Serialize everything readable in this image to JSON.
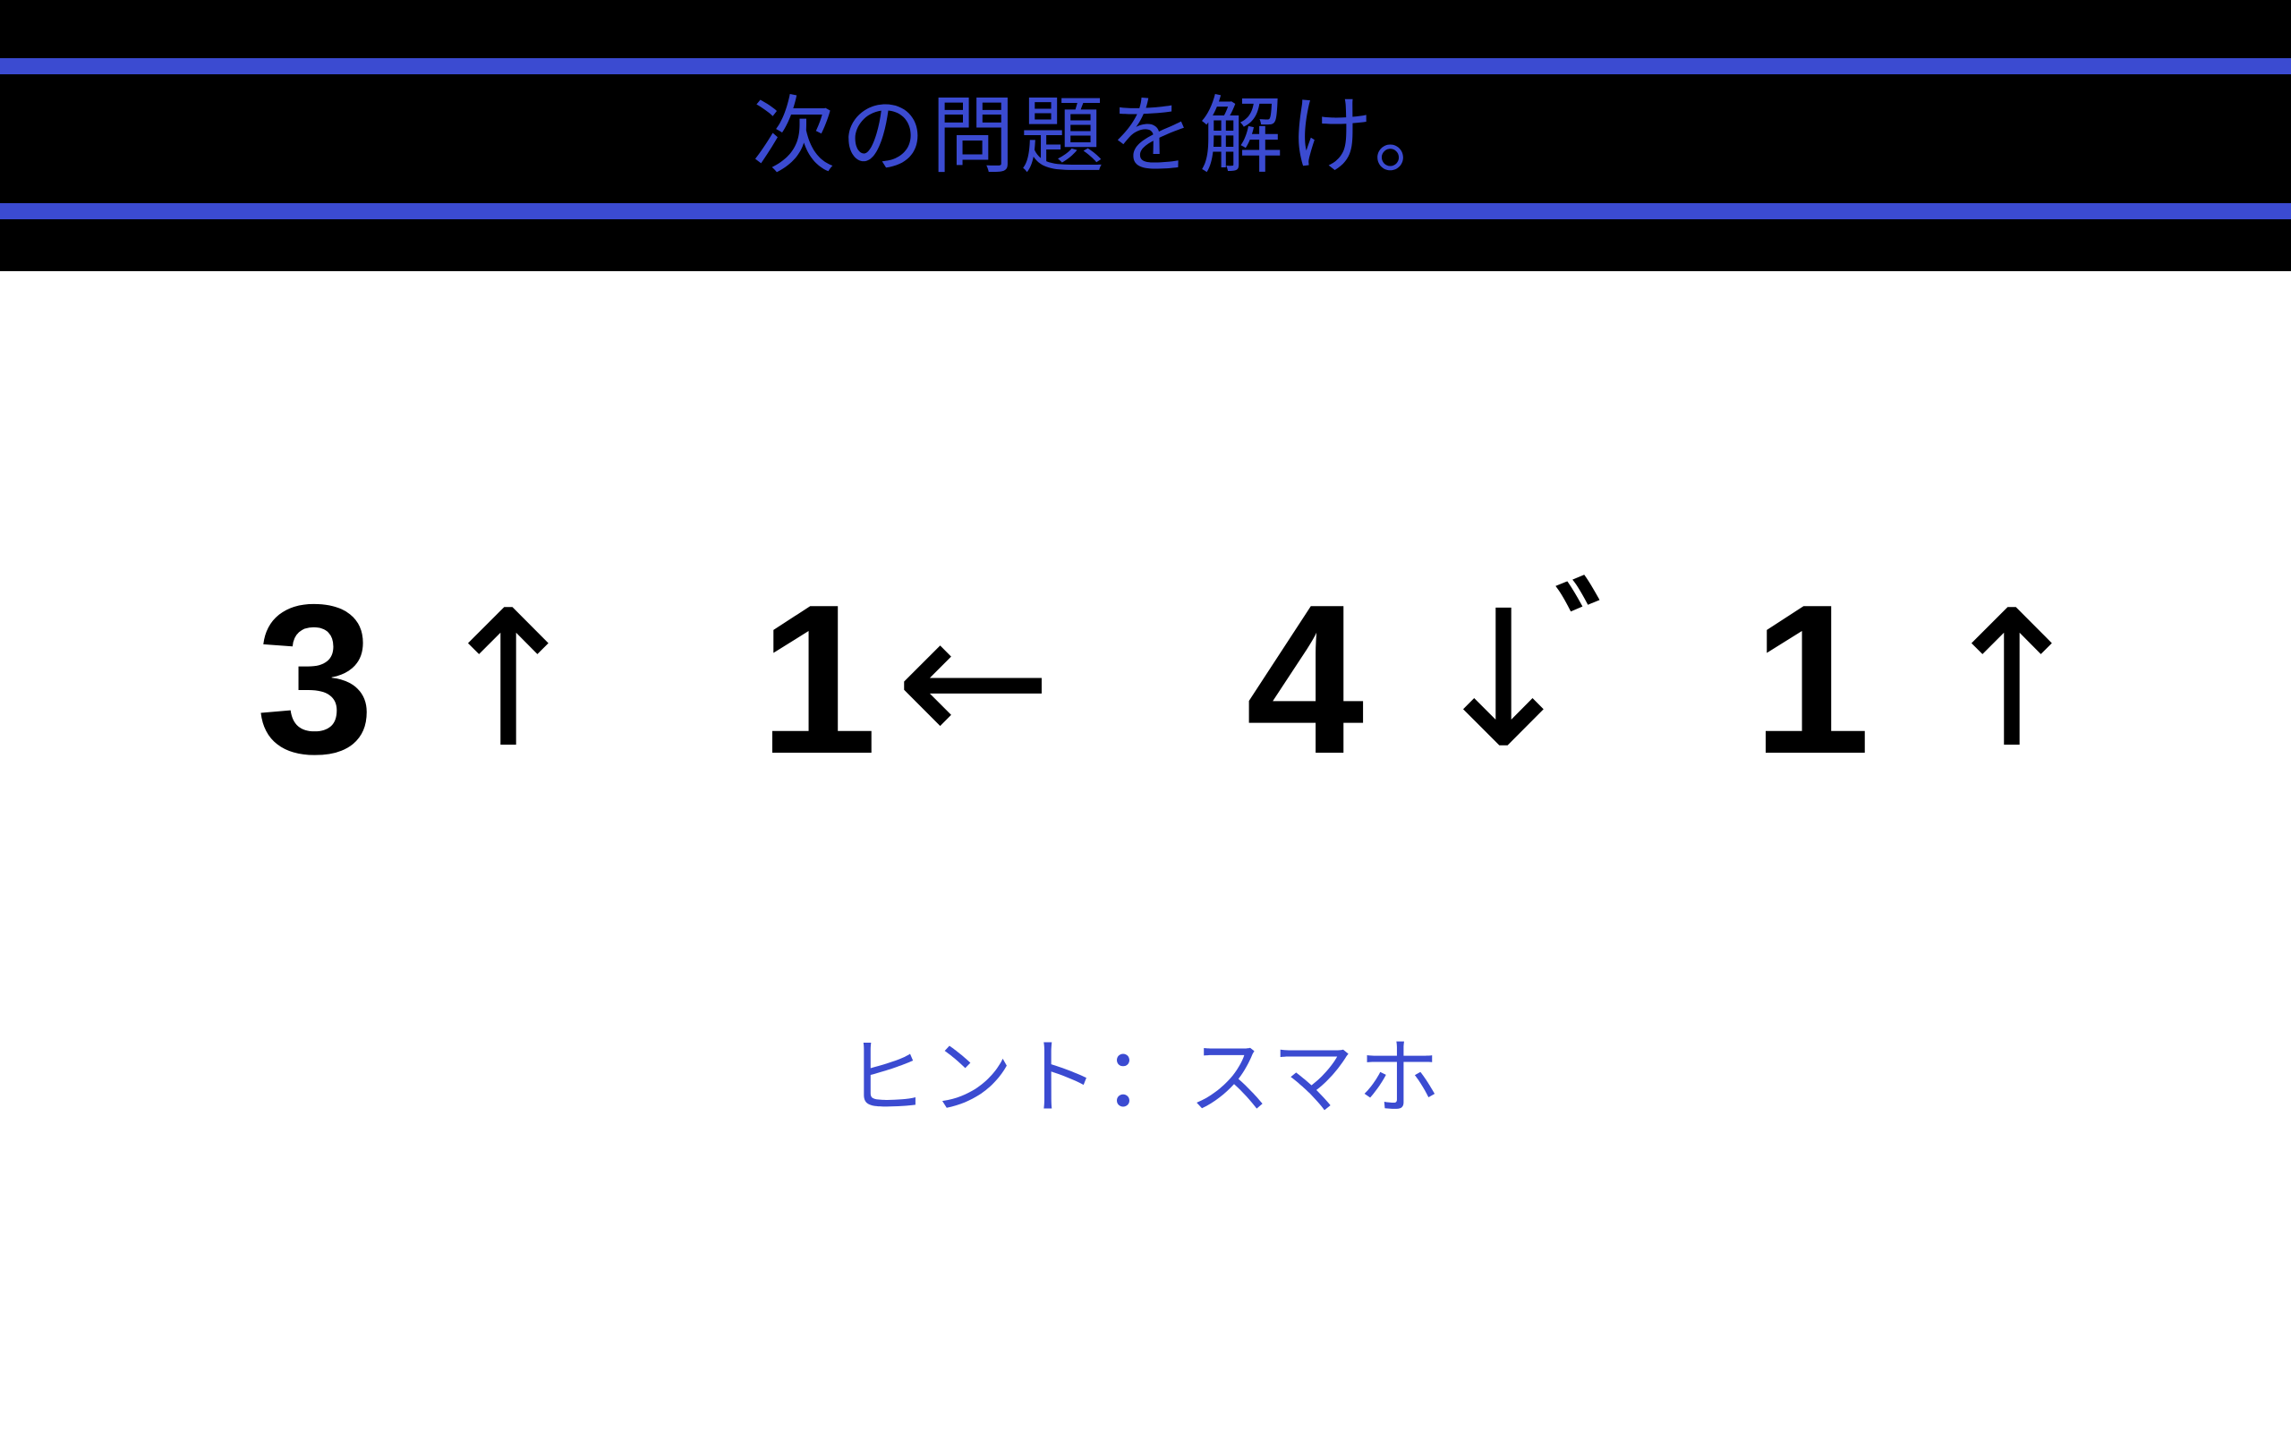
{
  "colors": {
    "accent": "#3b4bd1",
    "header_bg": "#000000",
    "background": "#ffffff",
    "text": "#000000"
  },
  "header": {
    "title": "次の問題を解け。"
  },
  "puzzle": {
    "tokens": [
      {
        "digit": "3",
        "arrow": "↑"
      },
      {
        "digit": "1",
        "arrow": "←"
      },
      {
        "digit": "4",
        "arrow": "↓",
        "mark": "゛"
      },
      {
        "digit": "1",
        "arrow": "↑"
      }
    ]
  },
  "hint": {
    "text": "ヒント：スマホ"
  }
}
